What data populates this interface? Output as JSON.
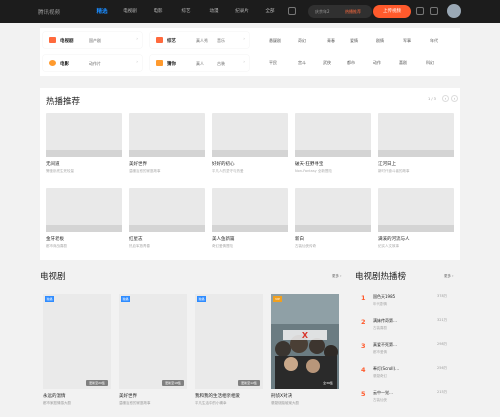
{
  "header": {
    "logo": "腾讯视频",
    "nav": [
      "精选",
      "电视剧",
      "电影",
      "综艺",
      "动漫",
      "纪录片",
      "全部"
    ],
    "search_placeholder": "庆余年2",
    "search_hot": "热播推荐",
    "upload_label": "上传视频"
  },
  "filter": {
    "chips": [
      {
        "label": "电视剧",
        "t1": "国产剧",
        "t2": "",
        "icon_color": "#ff6a3d"
      },
      {
        "label": "综艺",
        "t1": "真人秀",
        "t2": "音乐",
        "icon_color": "#ff6a3d"
      },
      {
        "label": "电影",
        "t1": "动作片",
        "t2": "",
        "icon_color": "#ff9a2e"
      },
      {
        "label": "猜你",
        "t1": "真人",
        "t2": "古装",
        "icon_color": "#ff9a2e"
      }
    ],
    "genres_row1": [
      "悬疑剧",
      "奇幻",
      "青春",
      "爱情",
      "剧情",
      "军事",
      "年代"
    ],
    "genres_row2": [
      "平民",
      "宫斗",
      "武侠",
      "都市",
      "动作",
      "喜剧",
      "科幻"
    ]
  },
  "hot": {
    "title": "热播推荐",
    "pager": "1 / 3",
    "cards": [
      {
        "title": "无间道",
        "sub": "警匪卧底生死较量",
        "ov": ""
      },
      {
        "title": "美好世界",
        "sub": "温暖治愈的家庭故事",
        "ov": ""
      },
      {
        "title": "好好的初心",
        "sub": "平凡人的坚守与热爱",
        "ov": ""
      },
      {
        "title": "破天·狂野寻宝",
        "sub": "Non-Fantasy 全新冒险",
        "ov": ""
      },
      {
        "title": "江河日上",
        "sub": "新时代奋斗者的故事",
        "ov": ""
      },
      {
        "title": "金牙老板",
        "sub": "都市商战喜剧",
        "ov": ""
      },
      {
        "title": "红星志",
        "sub": "热血军旅青春",
        "ov": ""
      },
      {
        "title": "美人鱼新篇",
        "sub": "奇幻爱情冒险",
        "ov": ""
      },
      {
        "title": "新白",
        "sub": "古装仙侠传奇",
        "ov": ""
      },
      {
        "title": "满溪的河流与人",
        "sub": "纪实人文故事",
        "ov": ""
      }
    ]
  },
  "tv": {
    "title": "电视剧",
    "more": "更多 ›",
    "cards": [
      {
        "title": "永远的温情",
        "sub": "都市家庭情感大剧",
        "tag": "独播",
        "ep": "更新至20集"
      },
      {
        "title": "美好世界",
        "sub": "温暖治愈的家庭故事",
        "tag": "独播",
        "ep": "更新至18集"
      },
      {
        "title": "我和我的生活相亲相爱",
        "sub": "平凡生活中的小确幸",
        "tag": "独播",
        "ep": "更新至12集"
      },
      {
        "title": "刑侦X对决",
        "sub": "悬疑烧脑破案大剧",
        "tag": "VIP",
        "ep": "全36集"
      }
    ]
  },
  "ranking": {
    "title": "电视剧热播榜",
    "more": "更多 ›",
    "items": [
      {
        "n": "1",
        "t": "国色天1985",
        "s": "年代剧情",
        "h": "378万"
      },
      {
        "n": "2",
        "t": "满妹传奇第…",
        "s": "古装喜剧",
        "h": "321万"
      },
      {
        "n": "3",
        "t": "真爱不死第…",
        "s": "都市爱情",
        "h": "298万"
      },
      {
        "n": "4",
        "t": "奉灯(Scroll)…",
        "s": "悬疑奇幻",
        "h": "256万"
      },
      {
        "n": "5",
        "t": "云中一觉…",
        "s": "古装仙侠",
        "h": "215万"
      }
    ]
  },
  "colors": {
    "accent": "#ff5a2c",
    "brand": "#1a8cff",
    "topbar": "#1c1c1c"
  }
}
